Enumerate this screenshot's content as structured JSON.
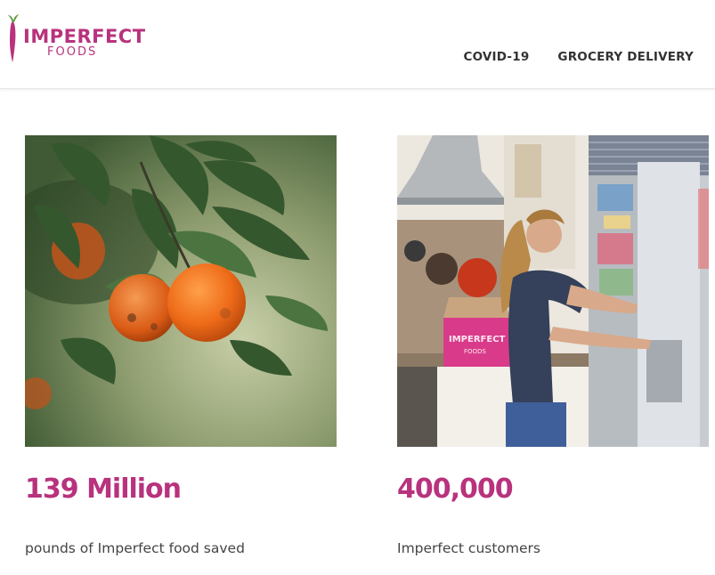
{
  "brand": {
    "name_line1": "IMPERFECT",
    "name_line2": "FOODS",
    "color": "#b8327d"
  },
  "nav": {
    "items": [
      {
        "label": "COVID-19"
      },
      {
        "label": "GROCERY DELIVERY"
      }
    ]
  },
  "stats": [
    {
      "value": "139 Million",
      "caption": "pounds of Imperfect food saved",
      "image": "oranges-on-branch-photo"
    },
    {
      "value": "400,000",
      "caption": "Imperfect customers",
      "image": "woman-at-refrigerator-photo"
    }
  ],
  "box_label": {
    "line1": "IMPERFECT",
    "line2": "FOODS"
  }
}
